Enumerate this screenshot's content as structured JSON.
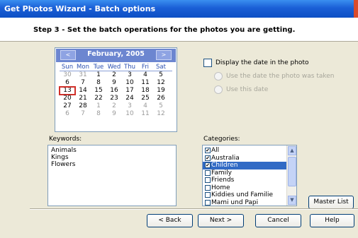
{
  "window": {
    "title": "Get Photos Wizard - Batch options"
  },
  "step": {
    "title": "Step 3 - Set the batch operations for the photos you are getting."
  },
  "calendar": {
    "month_label": "February, 2005",
    "prev_label": "<",
    "next_label": ">",
    "days_of_week": [
      "Sun",
      "Mon",
      "Tue",
      "Wed",
      "Thu",
      "Fri",
      "Sat"
    ],
    "weeks": [
      [
        "30",
        "31",
        "1",
        "2",
        "3",
        "4",
        "5"
      ],
      [
        "6",
        "7",
        "8",
        "9",
        "10",
        "11",
        "12"
      ],
      [
        "13",
        "14",
        "15",
        "16",
        "17",
        "18",
        "19"
      ],
      [
        "20",
        "21",
        "22",
        "23",
        "24",
        "25",
        "26"
      ],
      [
        "27",
        "28",
        "1",
        "2",
        "3",
        "4",
        "5"
      ],
      [
        "6",
        "7",
        "8",
        "9",
        "10",
        "11",
        "12"
      ]
    ],
    "selected_day": "13"
  },
  "options": {
    "display_date_label": "Display the date in the photo",
    "display_date_checked": false,
    "use_taken_date_label": "Use the date the photo was taken",
    "use_this_date_label": "Use this date"
  },
  "keywords": {
    "label": "Keywords:",
    "items": [
      "Animals",
      "Kings",
      "Flowers"
    ]
  },
  "categories": {
    "label": "Categories:",
    "items": [
      {
        "label": "All",
        "checked": true,
        "selected": false
      },
      {
        "label": "Australia",
        "checked": true,
        "selected": false
      },
      {
        "label": "Children",
        "checked": true,
        "selected": true
      },
      {
        "label": "Family",
        "checked": false,
        "selected": false
      },
      {
        "label": "Friends",
        "checked": false,
        "selected": false
      },
      {
        "label": "Home",
        "checked": false,
        "selected": false
      },
      {
        "label": "Kiddies und Familie",
        "checked": false,
        "selected": false
      },
      {
        "label": "Mami und Papi",
        "checked": false,
        "selected": false
      }
    ]
  },
  "buttons": {
    "master_list": "Master List",
    "back": "< Back",
    "next": "Next >",
    "cancel": "Cancel",
    "help": "Help"
  },
  "colors": {
    "title_bar": "#0d4fc4",
    "calendar_header": "#6c86d0",
    "selection": "#316ac5",
    "today_outline": "#d0302a"
  }
}
